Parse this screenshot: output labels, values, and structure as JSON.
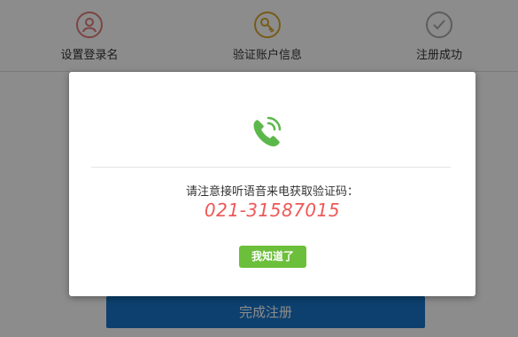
{
  "steps": [
    {
      "label": "设置登录名",
      "icon": "user-icon"
    },
    {
      "label": "验证账户信息",
      "icon": "key-icon"
    },
    {
      "label": "注册成功",
      "icon": "check-icon"
    }
  ],
  "bottom_button": {
    "label": "完成注册"
  },
  "modal": {
    "icon": "phone-call-icon",
    "message": "请注意接听语音来电获取验证码：",
    "phone_number": "021-31587015",
    "ok_label": "我知道了"
  },
  "colors": {
    "accent_red": "#ef5757",
    "button_green": "#6cbf3a",
    "button_blue": "#1976c9",
    "phone_green": "#5cb84a"
  }
}
